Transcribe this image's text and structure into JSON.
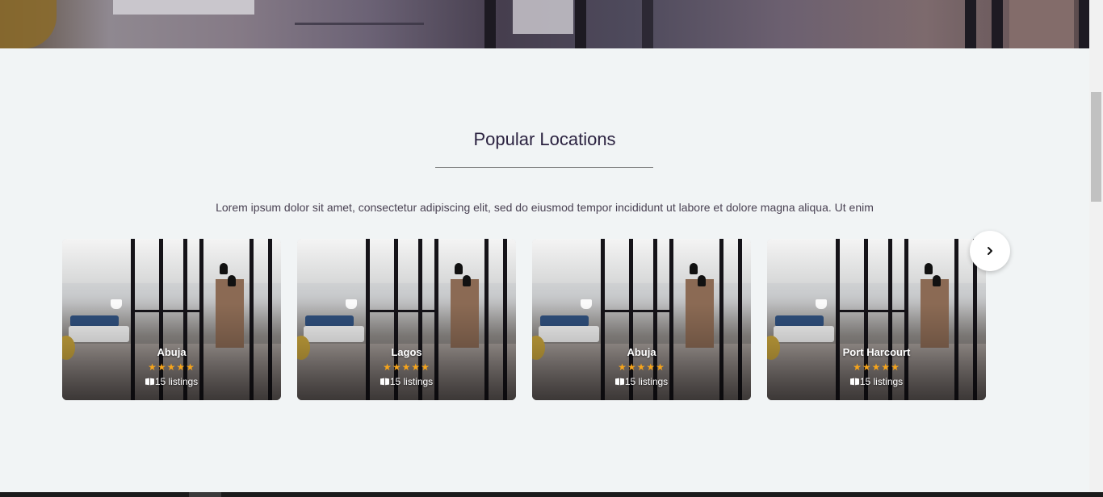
{
  "section": {
    "title": "Popular Locations",
    "description": "Lorem ipsum dolor sit amet, consectetur adipiscing elit, sed do eiusmod tempor incididunt ut labore et dolore magna aliqua. Ut enim"
  },
  "locations": [
    {
      "name": "Abuja",
      "rating": 5,
      "stars": "★★★★★",
      "listings": "15 listings"
    },
    {
      "name": "Lagos",
      "rating": 5,
      "stars": "★★★★★",
      "listings": "15 listings"
    },
    {
      "name": "Abuja",
      "rating": 5,
      "stars": "★★★★★",
      "listings": "15 listings"
    },
    {
      "name": "Port Harcourt",
      "rating": 5,
      "stars": "★★★★★",
      "listings": "15 listings"
    }
  ],
  "carousel": {
    "next_icon": "chevron-right-icon"
  },
  "icons": {
    "listings": "book-open-icon",
    "rating": "star-icon"
  },
  "colors": {
    "star": "#f7a51b",
    "title": "#2b2240",
    "background": "#f1f4f5"
  }
}
